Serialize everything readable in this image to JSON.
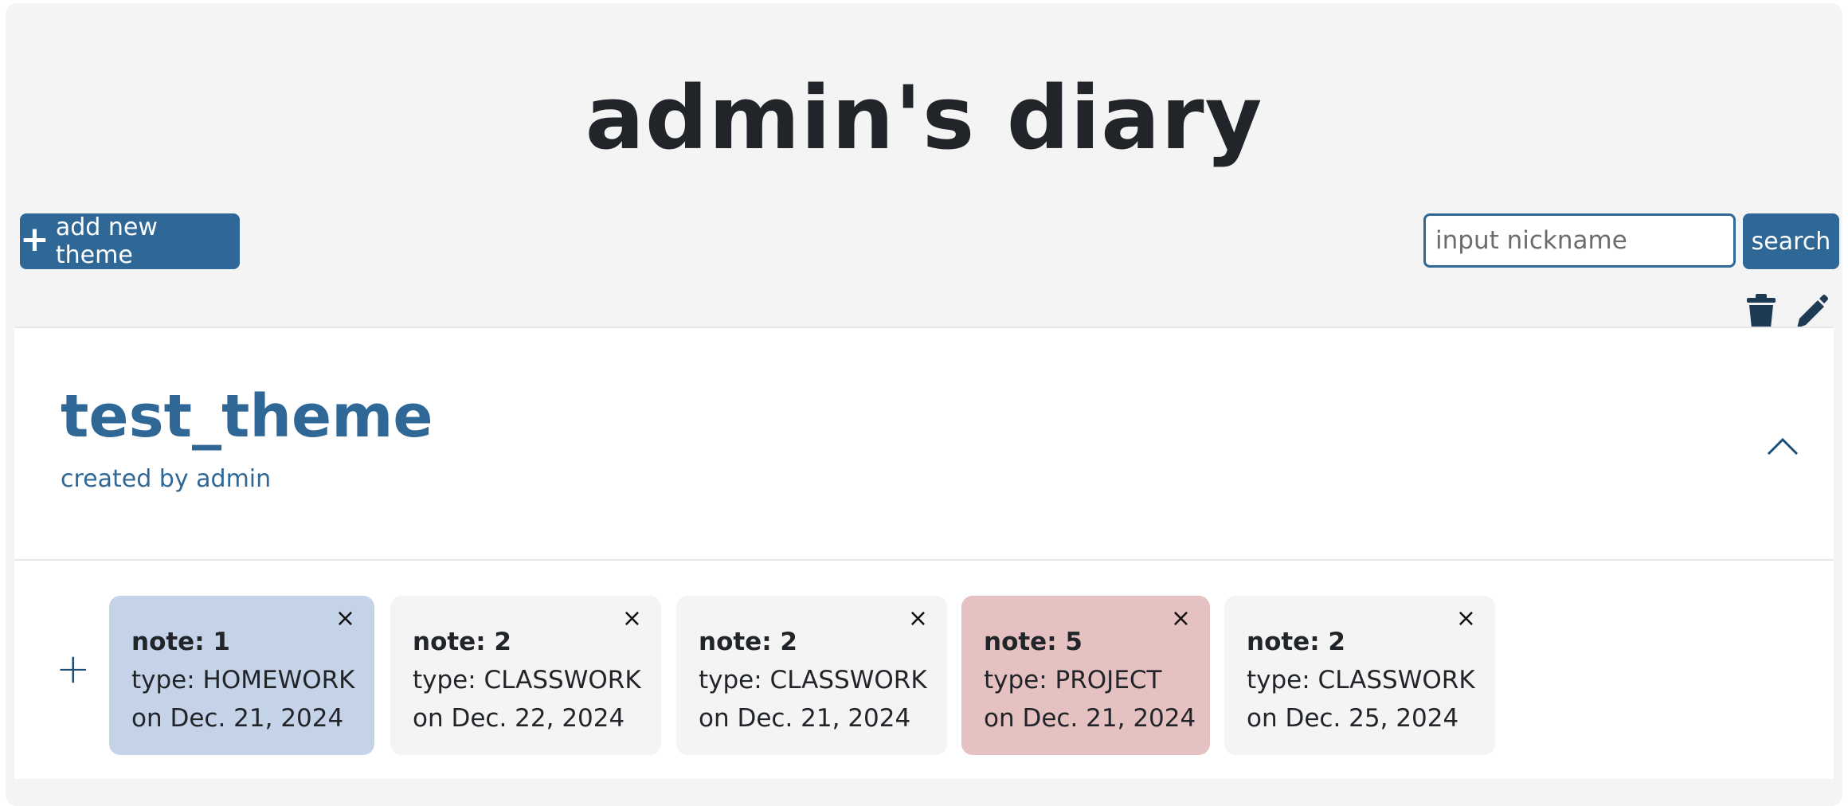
{
  "page": {
    "title": "admin's diary"
  },
  "toolbar": {
    "add_plus": "+",
    "add_theme_label": "add new theme",
    "search_placeholder": "input nickname",
    "search_value": "",
    "search_label": "search"
  },
  "theme": {
    "name": "test_theme",
    "author_line": "created by admin",
    "add_note_glyph": "+",
    "notes": [
      {
        "title": "note: 1",
        "type": "type: HOMEWORK",
        "date": "on Dec. 21, 2024",
        "color": "blue"
      },
      {
        "title": "note: 2",
        "type": "type: CLASSWORK",
        "date": "on Dec. 22, 2024",
        "color": "gray"
      },
      {
        "title": "note: 2",
        "type": "type: CLASSWORK",
        "date": "on Dec. 21, 2024",
        "color": "gray"
      },
      {
        "title": "note: 5",
        "type": "type: PROJECT",
        "date": "on Dec. 21, 2024",
        "color": "red"
      },
      {
        "title": "note: 2",
        "type": "type: CLASSWORK",
        "date": "on Dec. 25, 2024",
        "color": "gray"
      }
    ],
    "close_glyph": "×"
  },
  "colors": {
    "accent": "#2f6796",
    "note_homework": "#c4d3e8",
    "note_project": "#e6c1c1",
    "note_classwork": "#f4f4f4"
  },
  "icons": {
    "delete": "trash-icon",
    "edit": "pencil-icon",
    "collapse": "chevron-up-icon",
    "add": "plus-icon",
    "close": "close-icon"
  }
}
